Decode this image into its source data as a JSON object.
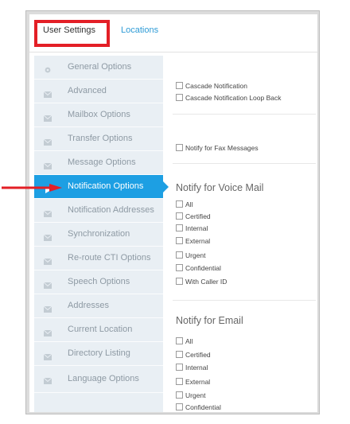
{
  "tabs": {
    "user_settings": "User Settings",
    "locations": "Locations"
  },
  "sidebar": {
    "items": [
      {
        "label": "General Options",
        "icon": "gear-icon"
      },
      {
        "label": "Advanced",
        "icon": "envelope-icon"
      },
      {
        "label": "Mailbox Options",
        "icon": "envelope-icon"
      },
      {
        "label": "Transfer Options",
        "icon": "envelope-icon"
      },
      {
        "label": "Message Options",
        "icon": "envelope-icon"
      },
      {
        "label": "Notification Options",
        "icon": "envelope-icon",
        "active": true
      },
      {
        "label": "Notification Addresses",
        "icon": "envelope-icon"
      },
      {
        "label": "Synchronization",
        "icon": "envelope-icon"
      },
      {
        "label": "Re-route CTI Options",
        "icon": "envelope-icon"
      },
      {
        "label": "Speech Options",
        "icon": "envelope-icon"
      },
      {
        "label": "Addresses",
        "icon": "envelope-icon"
      },
      {
        "label": "Current Location",
        "icon": "envelope-icon"
      },
      {
        "label": "Directory Listing",
        "icon": "envelope-icon"
      },
      {
        "label": "Language Options",
        "icon": "envelope-icon"
      }
    ]
  },
  "content": {
    "cascade_notification": "Cascade Notification",
    "cascade_loop_back": "Cascade Notification Loop Back",
    "notify_fax": "Notify for Fax Messages",
    "voice_mail": {
      "heading": "Notify for Voice Mail",
      "options": [
        "All",
        "Certified",
        "Internal",
        "External",
        "Urgent",
        "Confidential",
        "With Caller ID"
      ]
    },
    "email": {
      "heading": "Notify for Email",
      "options": [
        "All",
        "Certified",
        "Internal",
        "External",
        "Urgent",
        "Confidential"
      ]
    }
  },
  "colors": {
    "accent": "#1d9fe3",
    "highlight": "#e31f26",
    "link": "#2e9bd6"
  }
}
